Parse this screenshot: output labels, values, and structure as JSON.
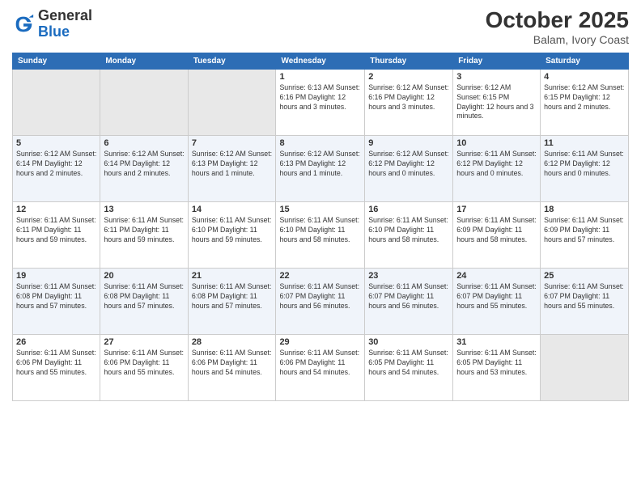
{
  "header": {
    "logo_general": "General",
    "logo_blue": "Blue",
    "month": "October 2025",
    "location": "Balam, Ivory Coast"
  },
  "weekdays": [
    "Sunday",
    "Monday",
    "Tuesday",
    "Wednesday",
    "Thursday",
    "Friday",
    "Saturday"
  ],
  "weeks": [
    [
      {
        "day": "",
        "info": ""
      },
      {
        "day": "",
        "info": ""
      },
      {
        "day": "",
        "info": ""
      },
      {
        "day": "1",
        "info": "Sunrise: 6:13 AM\nSunset: 6:16 PM\nDaylight: 12 hours\nand 3 minutes."
      },
      {
        "day": "2",
        "info": "Sunrise: 6:12 AM\nSunset: 6:16 PM\nDaylight: 12 hours\nand 3 minutes."
      },
      {
        "day": "3",
        "info": "Sunrise: 6:12 AM\nSunset: 6:15 PM\nDaylight: 12 hours\nand 3 minutes."
      },
      {
        "day": "4",
        "info": "Sunrise: 6:12 AM\nSunset: 6:15 PM\nDaylight: 12 hours\nand 2 minutes."
      }
    ],
    [
      {
        "day": "5",
        "info": "Sunrise: 6:12 AM\nSunset: 6:14 PM\nDaylight: 12 hours\nand 2 minutes."
      },
      {
        "day": "6",
        "info": "Sunrise: 6:12 AM\nSunset: 6:14 PM\nDaylight: 12 hours\nand 2 minutes."
      },
      {
        "day": "7",
        "info": "Sunrise: 6:12 AM\nSunset: 6:13 PM\nDaylight: 12 hours\nand 1 minute."
      },
      {
        "day": "8",
        "info": "Sunrise: 6:12 AM\nSunset: 6:13 PM\nDaylight: 12 hours\nand 1 minute."
      },
      {
        "day": "9",
        "info": "Sunrise: 6:12 AM\nSunset: 6:12 PM\nDaylight: 12 hours\nand 0 minutes."
      },
      {
        "day": "10",
        "info": "Sunrise: 6:11 AM\nSunset: 6:12 PM\nDaylight: 12 hours\nand 0 minutes."
      },
      {
        "day": "11",
        "info": "Sunrise: 6:11 AM\nSunset: 6:12 PM\nDaylight: 12 hours\nand 0 minutes."
      }
    ],
    [
      {
        "day": "12",
        "info": "Sunrise: 6:11 AM\nSunset: 6:11 PM\nDaylight: 11 hours\nand 59 minutes."
      },
      {
        "day": "13",
        "info": "Sunrise: 6:11 AM\nSunset: 6:11 PM\nDaylight: 11 hours\nand 59 minutes."
      },
      {
        "day": "14",
        "info": "Sunrise: 6:11 AM\nSunset: 6:10 PM\nDaylight: 11 hours\nand 59 minutes."
      },
      {
        "day": "15",
        "info": "Sunrise: 6:11 AM\nSunset: 6:10 PM\nDaylight: 11 hours\nand 58 minutes."
      },
      {
        "day": "16",
        "info": "Sunrise: 6:11 AM\nSunset: 6:10 PM\nDaylight: 11 hours\nand 58 minutes."
      },
      {
        "day": "17",
        "info": "Sunrise: 6:11 AM\nSunset: 6:09 PM\nDaylight: 11 hours\nand 58 minutes."
      },
      {
        "day": "18",
        "info": "Sunrise: 6:11 AM\nSunset: 6:09 PM\nDaylight: 11 hours\nand 57 minutes."
      }
    ],
    [
      {
        "day": "19",
        "info": "Sunrise: 6:11 AM\nSunset: 6:08 PM\nDaylight: 11 hours\nand 57 minutes."
      },
      {
        "day": "20",
        "info": "Sunrise: 6:11 AM\nSunset: 6:08 PM\nDaylight: 11 hours\nand 57 minutes."
      },
      {
        "day": "21",
        "info": "Sunrise: 6:11 AM\nSunset: 6:08 PM\nDaylight: 11 hours\nand 57 minutes."
      },
      {
        "day": "22",
        "info": "Sunrise: 6:11 AM\nSunset: 6:07 PM\nDaylight: 11 hours\nand 56 minutes."
      },
      {
        "day": "23",
        "info": "Sunrise: 6:11 AM\nSunset: 6:07 PM\nDaylight: 11 hours\nand 56 minutes."
      },
      {
        "day": "24",
        "info": "Sunrise: 6:11 AM\nSunset: 6:07 PM\nDaylight: 11 hours\nand 55 minutes."
      },
      {
        "day": "25",
        "info": "Sunrise: 6:11 AM\nSunset: 6:07 PM\nDaylight: 11 hours\nand 55 minutes."
      }
    ],
    [
      {
        "day": "26",
        "info": "Sunrise: 6:11 AM\nSunset: 6:06 PM\nDaylight: 11 hours\nand 55 minutes."
      },
      {
        "day": "27",
        "info": "Sunrise: 6:11 AM\nSunset: 6:06 PM\nDaylight: 11 hours\nand 55 minutes."
      },
      {
        "day": "28",
        "info": "Sunrise: 6:11 AM\nSunset: 6:06 PM\nDaylight: 11 hours\nand 54 minutes."
      },
      {
        "day": "29",
        "info": "Sunrise: 6:11 AM\nSunset: 6:06 PM\nDaylight: 11 hours\nand 54 minutes."
      },
      {
        "day": "30",
        "info": "Sunrise: 6:11 AM\nSunset: 6:05 PM\nDaylight: 11 hours\nand 54 minutes."
      },
      {
        "day": "31",
        "info": "Sunrise: 6:11 AM\nSunset: 6:05 PM\nDaylight: 11 hours\nand 53 minutes."
      },
      {
        "day": "",
        "info": ""
      }
    ]
  ]
}
